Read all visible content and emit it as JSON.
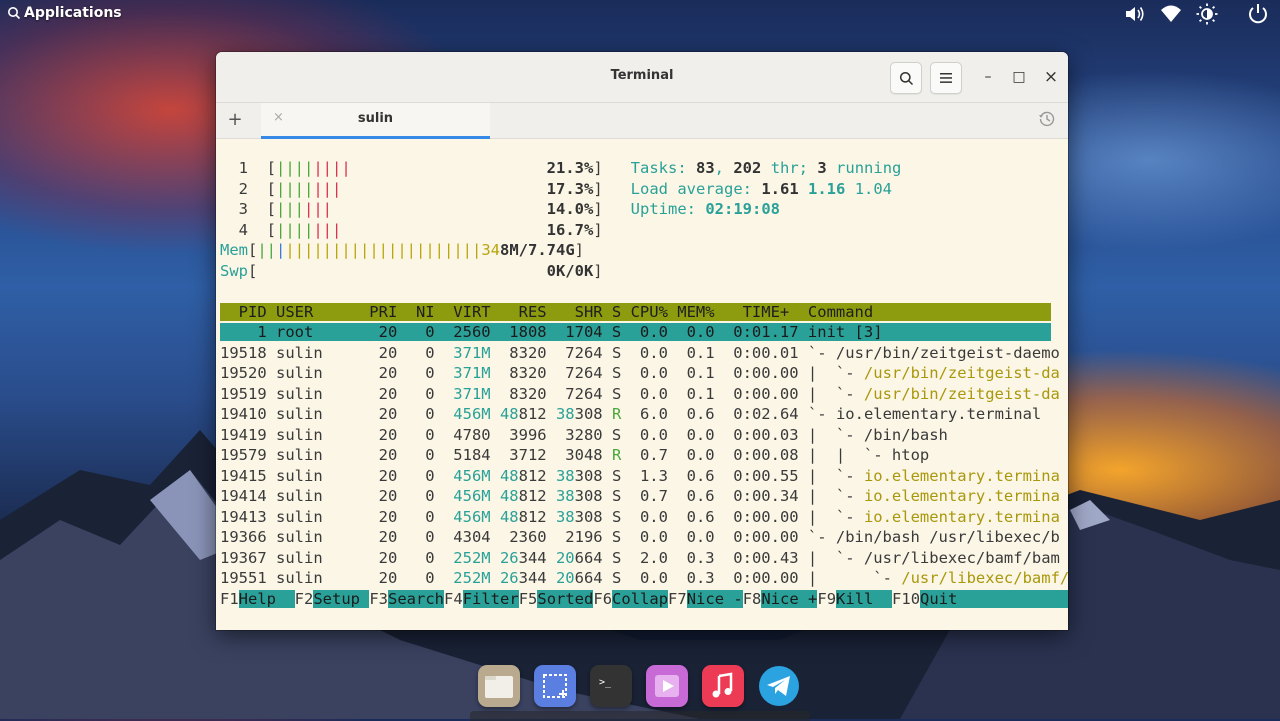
{
  "panel": {
    "applications_label": "Applications",
    "indicators": [
      "volume-icon",
      "wifi-icon",
      "brightness-icon",
      "power-icon"
    ]
  },
  "window": {
    "title": "Terminal",
    "tab_label": "sulin",
    "new_tab": "+",
    "tab_close": "×",
    "controls": {
      "minimize": "–",
      "maximize": "□",
      "close": "×"
    }
  },
  "htop": {
    "cpus": [
      {
        "id": "1",
        "percent": "21.3%"
      },
      {
        "id": "2",
        "percent": "17.3%"
      },
      {
        "id": "3",
        "percent": "14.0%"
      },
      {
        "id": "4",
        "percent": "16.7%"
      }
    ],
    "mem_label": "Mem",
    "mem_value": "348M/7.74G",
    "swp_label": "Swp",
    "swp_value": "0K/0K",
    "tasks_label": "Tasks:",
    "tasks": "83",
    "threads": "202",
    "thr_label": "thr;",
    "running": "3",
    "running_label": "running",
    "load_label": "Load average:",
    "load_1": "1.61",
    "load_5": "1.16",
    "load_15": "1.04",
    "uptime_label": "Uptime:",
    "uptime": "02:19:08",
    "columns": [
      "PID",
      "USER",
      "PRI",
      "NI",
      "VIRT",
      "RES",
      "SHR",
      "S",
      "CPU%",
      "MEM%",
      "TIME+",
      "Command"
    ],
    "processes": [
      {
        "pid": "1",
        "user": "root",
        "pri": "20",
        "ni": "0",
        "virt": "2560",
        "res": "1808",
        "shr": "1704",
        "s": "S",
        "cpu": "0.0",
        "mem": "0.0",
        "time": "0:01.17",
        "cmd": "init [3]"
      },
      {
        "pid": "19518",
        "user": "sulin",
        "pri": "20",
        "ni": "0",
        "virt": "371M",
        "res": "8320",
        "shr": "7264",
        "s": "S",
        "cpu": "0.0",
        "mem": "0.1",
        "time": "0:00.01",
        "cmd": "`- /usr/bin/zeitgeist-daemo"
      },
      {
        "pid": "19520",
        "user": "sulin",
        "pri": "20",
        "ni": "0",
        "virt": "371M",
        "res": "8320",
        "shr": "7264",
        "s": "S",
        "cpu": "0.0",
        "mem": "0.1",
        "time": "0:00.00",
        "cmd": "|  `- /usr/bin/zeitgeist-da"
      },
      {
        "pid": "19519",
        "user": "sulin",
        "pri": "20",
        "ni": "0",
        "virt": "371M",
        "res": "8320",
        "shr": "7264",
        "s": "S",
        "cpu": "0.0",
        "mem": "0.1",
        "time": "0:00.00",
        "cmd": "|  `- /usr/bin/zeitgeist-da"
      },
      {
        "pid": "19410",
        "user": "sulin",
        "pri": "20",
        "ni": "0",
        "virt": "456M",
        "res": "48812",
        "shr": "38308",
        "s": "R",
        "cpu": "6.0",
        "mem": "0.6",
        "time": "0:02.64",
        "cmd": "`- io.elementary.terminal"
      },
      {
        "pid": "19419",
        "user": "sulin",
        "pri": "20",
        "ni": "0",
        "virt": "4780",
        "res": "3996",
        "shr": "3280",
        "s": "S",
        "cpu": "0.0",
        "mem": "0.0",
        "time": "0:00.03",
        "cmd": "|  `- /bin/bash"
      },
      {
        "pid": "19579",
        "user": "sulin",
        "pri": "20",
        "ni": "0",
        "virt": "5184",
        "res": "3712",
        "shr": "3048",
        "s": "R",
        "cpu": "0.7",
        "mem": "0.0",
        "time": "0:00.08",
        "cmd": "|  |  `- htop"
      },
      {
        "pid": "19415",
        "user": "sulin",
        "pri": "20",
        "ni": "0",
        "virt": "456M",
        "res": "48812",
        "shr": "38308",
        "s": "S",
        "cpu": "1.3",
        "mem": "0.6",
        "time": "0:00.55",
        "cmd": "|  `- io.elementary.termina"
      },
      {
        "pid": "19414",
        "user": "sulin",
        "pri": "20",
        "ni": "0",
        "virt": "456M",
        "res": "48812",
        "shr": "38308",
        "s": "S",
        "cpu": "0.7",
        "mem": "0.6",
        "time": "0:00.34",
        "cmd": "|  `- io.elementary.termina"
      },
      {
        "pid": "19413",
        "user": "sulin",
        "pri": "20",
        "ni": "0",
        "virt": "456M",
        "res": "48812",
        "shr": "38308",
        "s": "S",
        "cpu": "0.0",
        "mem": "0.6",
        "time": "0:00.00",
        "cmd": "|  `- io.elementary.termina"
      },
      {
        "pid": "19366",
        "user": "sulin",
        "pri": "20",
        "ni": "0",
        "virt": "4304",
        "res": "2360",
        "shr": "2196",
        "s": "S",
        "cpu": "0.0",
        "mem": "0.0",
        "time": "0:00.00",
        "cmd": "`- /bin/bash /usr/libexec/b"
      },
      {
        "pid": "19367",
        "user": "sulin",
        "pri": "20",
        "ni": "0",
        "virt": "252M",
        "res": "26344",
        "shr": "20664",
        "s": "S",
        "cpu": "2.0",
        "mem": "0.3",
        "time": "0:00.43",
        "cmd": "   `- /usr/libexec/bamf/bam"
      },
      {
        "pid": "19551",
        "user": "sulin",
        "pri": "20",
        "ni": "0",
        "virt": "252M",
        "res": "26344",
        "shr": "20664",
        "s": "S",
        "cpu": "0.0",
        "mem": "0.3",
        "time": "0:00.00",
        "cmd": "|      `- /usr/libexec/bamf/"
      }
    ],
    "function_keys": [
      {
        "key": "F1",
        "label": "Help  "
      },
      {
        "key": "F2",
        "label": "Setup "
      },
      {
        "key": "F3",
        "label": "Search"
      },
      {
        "key": "F4",
        "label": "Filter"
      },
      {
        "key": "F5",
        "label": "Sorted"
      },
      {
        "key": "F6",
        "label": "Collap"
      },
      {
        "key": "F7",
        "label": "Nice -"
      },
      {
        "key": "F8",
        "label": "Nice +"
      },
      {
        "key": "F9",
        "label": "Kill  "
      },
      {
        "key": "F10",
        "label": "Quit"
      }
    ]
  },
  "dock": {
    "apps": [
      "files-icon",
      "screenshot-icon",
      "terminal-icon",
      "videos-icon",
      "music-icon",
      "telegram-icon"
    ]
  },
  "colors": {
    "terminal_bg": "#fbf6e6",
    "header_bg": "#8d9c0e",
    "selected_bg": "#2aa198",
    "accent_tab": "#3689e6"
  }
}
